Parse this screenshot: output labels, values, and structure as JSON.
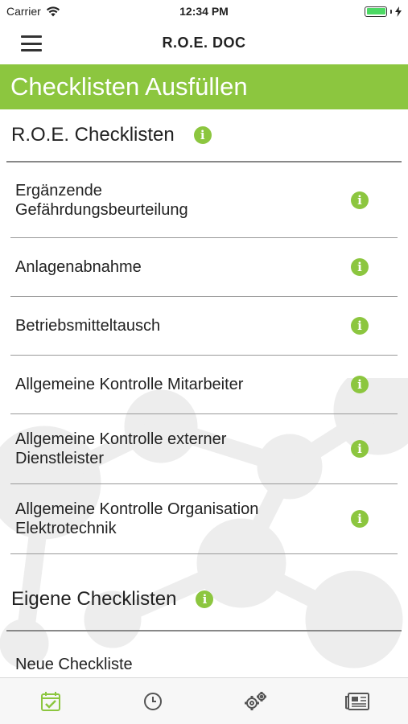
{
  "status_bar": {
    "carrier": "Carrier",
    "time": "12:34 PM",
    "battery_level": 1.0
  },
  "nav": {
    "title": "R.O.E. DOC",
    "menu_icon": "hamburger-menu-icon"
  },
  "banner": {
    "title": "Checklisten Ausfüllen",
    "color": "#8cc63f"
  },
  "sections": [
    {
      "label": "R.O.E. Checklisten",
      "items": [
        "Ergänzende\nGefährdungsbeurteilung",
        "Anlagenabnahme",
        "Betriebsmitteltausch",
        "Allgemeine Kontrolle Mitarbeiter",
        "Allgemeine Kontrolle externer\nDienstleister",
        "Allgemeine Kontrolle Organisation\nElektrotechnik"
      ]
    },
    {
      "label": "Eigene Checklisten",
      "items": [
        "Neue Checkliste"
      ]
    }
  ],
  "tab_bar": {
    "tabs": [
      {
        "icon": "calendar-check-icon",
        "active": true
      },
      {
        "icon": "clock-icon",
        "active": false
      },
      {
        "icon": "gears-icon",
        "active": false
      },
      {
        "icon": "newspaper-icon",
        "active": false
      }
    ],
    "active_color": "#8cc63f",
    "inactive_color": "#555555"
  }
}
